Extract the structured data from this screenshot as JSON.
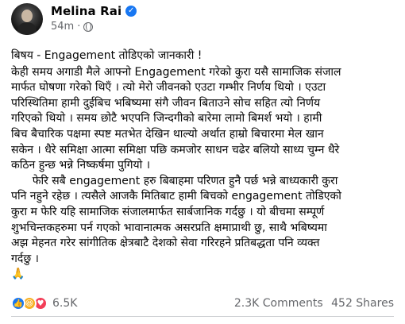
{
  "post": {
    "author": "Melina Rai",
    "time": "54m",
    "dot": "·",
    "subject": "बिषय - Engagement तोडिएको जानकारी !",
    "lines": [
      "केही समय अगाडी मैले आफ्नो Engagement गरेको कुरा यसै सामाजिक संजाल",
      "मार्फत घोषणा गरेको थिएँ । त्यो मेरो जीवनको एउटा गम्भीर निर्णय थियो । एउटा",
      "परिस्थितिमा हामी दुईबिच भबिष्यमा संगै जीवन बिताउने सोच सहित त्यो निर्णय",
      "गरिएको थियो । समय छोटै भएपनि  जिन्दगीको बारेमा लामो बिमर्श भयो । हामी",
      "बिच बैचारिक पक्षमा स्पष्ट मतभेत देखिन थाल्यो अर्थात हाम्रो बिचारमा मेल खान",
      "सकेन । धैरे समिक्षा आत्मा समिक्षा पछि कमजोर साधन चढेर बलियो साध्य चुम्न धैरे",
      "कठिन हुन्छ भन्ने निष्कर्षमा पुगियो ।"
    ],
    "lines2": [
      "      फेरि सबै engagement हरु बिबाहमा परिणत हुनै पर्छ भन्ने बाध्यकारी कुरा",
      "पनि नहुने रहेछ । त्यसैले आजकै मितिबाट हामी बिचको engagement  तोडिएको",
      "कुरा म  फेरि यहि सामाजिक संजालमार्फत सार्बजानिक गर्दछु । यो बीचमा सम्पूर्ण",
      "शुभचिन्तकहरुमा पर्न गएको भावानात्मक असरप्रति क्षमाप्राथी छु, साथै भबिष्यमा",
      "अझ मेहनत गरेर सांगीतिक क्षेत्रबाटै देशको सेवा गरिरहने प्रतिबद्धता पनि व्यक्त",
      "गर्दछु ।"
    ],
    "emoji": "🙏",
    "reaction_count": "6.5K",
    "comments": "2.3K Comments",
    "shares": "452 Shares",
    "verified_icon": "check-badge-icon",
    "audience_icon": "globe-icon"
  }
}
